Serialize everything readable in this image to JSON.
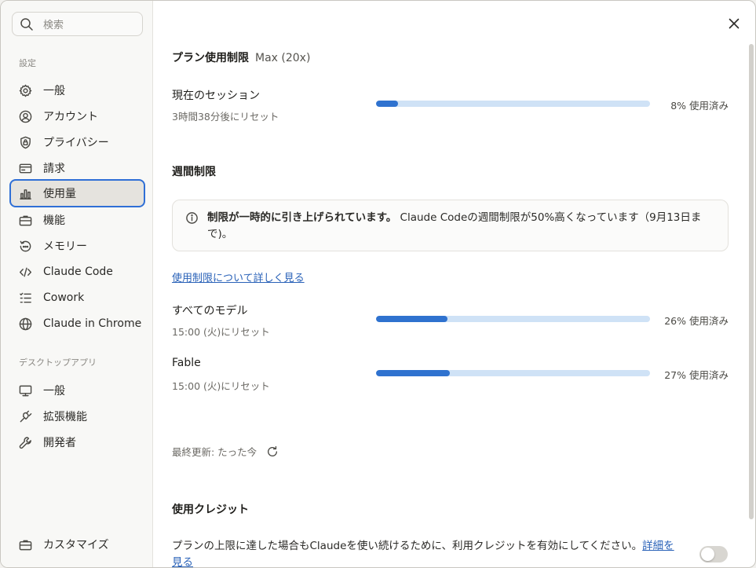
{
  "sidebar": {
    "search_placeholder": "検索",
    "settings_label": "設定",
    "items": [
      {
        "label": "一般",
        "icon": "gear-icon"
      },
      {
        "label": "アカウント",
        "icon": "user-circle-icon"
      },
      {
        "label": "プライバシー",
        "icon": "shield-lock-icon"
      },
      {
        "label": "請求",
        "icon": "credit-card-icon"
      },
      {
        "label": "使用量",
        "icon": "bar-chart-icon",
        "active": true
      },
      {
        "label": "機能",
        "icon": "briefcase-icon"
      },
      {
        "label": "メモリー",
        "icon": "history-icon"
      },
      {
        "label": "Claude Code",
        "icon": "code-icon"
      },
      {
        "label": "Cowork",
        "icon": "checklist-icon"
      },
      {
        "label": "Claude in Chrome",
        "icon": "globe-icon"
      }
    ],
    "desktop_label": "デスクトップアプリ",
    "desktop_items": [
      {
        "label": "一般",
        "icon": "monitor-icon"
      },
      {
        "label": "拡張機能",
        "icon": "plug-icon"
      },
      {
        "label": "開発者",
        "icon": "wrench-icon"
      }
    ],
    "customize": {
      "label": "カスタマイズ",
      "icon": "briefcase-icon"
    }
  },
  "main": {
    "plan_title": "プラン使用制限",
    "plan_name": "Max (20x)",
    "session": {
      "title": "現在のセッション",
      "reset": "3時間38分後にリセット",
      "percent": 8,
      "percent_label": "8% 使用済み"
    },
    "weekly_title": "週間制限",
    "notice": {
      "bold": "制限が一時的に引き上げられています。",
      "text": " Claude Codeの週間制限が50%高くなっています（9月13日まで)。"
    },
    "learn_more": "使用制限について詳しく見る",
    "limits": [
      {
        "title": "すべてのモデル",
        "reset": "15:00 (火)にリセット",
        "percent": 26,
        "percent_label": "26% 使用済み"
      },
      {
        "title": "Fable",
        "reset": "15:00 (火)にリセット",
        "percent": 27,
        "percent_label": "27% 使用済み"
      }
    ],
    "last_updated": "最終更新: たった今",
    "credits_title": "使用クレジット",
    "credits_text": "プランの上限に達した場合もClaudeを使い続けるために、利用クレジットを有効にしてください。",
    "credits_link": "詳細を見る",
    "credits_enabled": false
  },
  "colors": {
    "accent": "#2f72cf",
    "bar_track": "#cfe2f6",
    "link": "#2a62b8",
    "active_border": "#2f6fd6"
  }
}
